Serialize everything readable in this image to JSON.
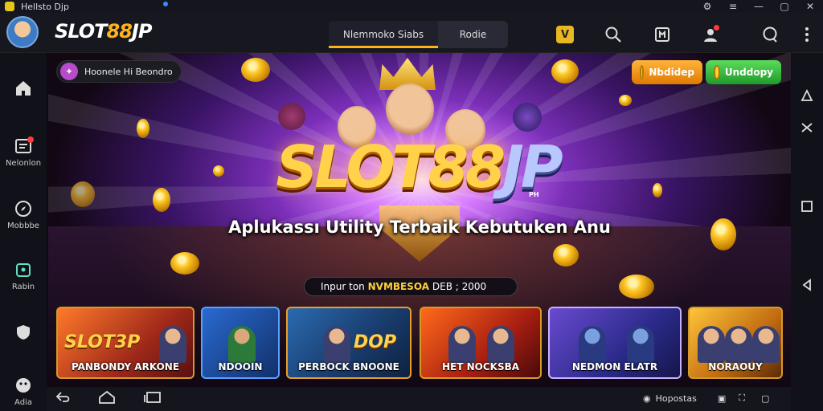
{
  "window": {
    "title": "Hellsto Djp",
    "controls": [
      "⚙",
      "≡",
      "—",
      "▢",
      "✕"
    ]
  },
  "header": {
    "logo_main": "SLOT",
    "logo_num": "88",
    "logo_tail": "JP",
    "tabs": [
      {
        "label": "Nlemmoko Siabs",
        "active": true
      },
      {
        "label": "Rodie",
        "active": false
      }
    ],
    "gold_badge": "ᐯ",
    "icons": [
      "search-icon",
      "gift-icon",
      "profile-icon",
      "chat-icon",
      "menu-dots-icon"
    ]
  },
  "sidebar": {
    "items": [
      {
        "icon": "home-icon",
        "label": ""
      },
      {
        "icon": "message-icon",
        "label": "Nelonlon"
      },
      {
        "icon": "compass-icon",
        "label": "Mobbbe"
      },
      {
        "icon": "share-icon",
        "label": "Rabin"
      },
      {
        "icon": "shield-icon",
        "label": ""
      },
      {
        "icon": "account-icon",
        "label": "Adia"
      }
    ]
  },
  "hero": {
    "badge": "Hoonele Hi Beondro",
    "btn_orange": "Nbdidep",
    "btn_green": "Unddopy",
    "title_main": "SLOT88",
    "title_tail": "JP",
    "title_small": "PH",
    "subtitle": "Aplukassı Utility Terbaik Kebutuken Anu",
    "input_prefix": "Inpur ton",
    "input_highlight": "NVMBESOA",
    "input_suffix": "DEB ; 2000"
  },
  "cards": [
    {
      "caption": "PANBONDY ARKONE",
      "logo": "SLOT3P"
    },
    {
      "caption": "NDOOIN",
      "logo": ""
    },
    {
      "caption": "PERBOCK BNOONE",
      "logo": "DOP"
    },
    {
      "caption": "HET NOCKSBA",
      "logo": ""
    },
    {
      "caption": "NEDMON ELATR",
      "logo": ""
    },
    {
      "caption": "NORAOUY",
      "logo": ""
    }
  ],
  "rightbar": [
    "expand-icon",
    "connect-icon",
    "square-icon",
    "back-arrow-icon"
  ],
  "bottombar": {
    "status_label": "Hopostas",
    "icons": [
      "back-icon",
      "home-outline-icon",
      "recents-icon"
    ]
  }
}
